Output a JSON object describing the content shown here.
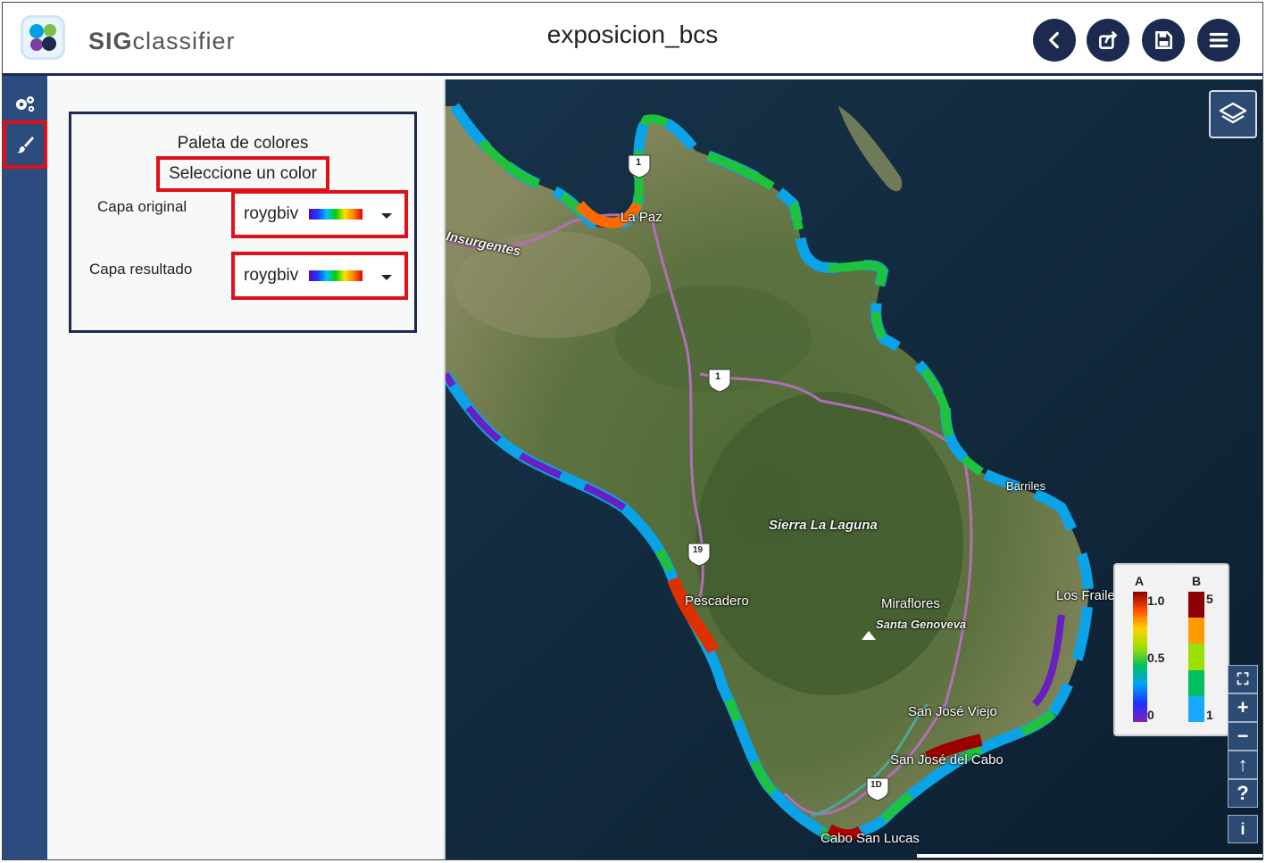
{
  "app": {
    "brand_bold": "SIG",
    "brand_rest": "classifier",
    "document_title": "exposicion_bcs"
  },
  "header_buttons": [
    {
      "name": "back-button",
      "icon": "chevron-left-icon"
    },
    {
      "name": "share-button",
      "icon": "share-icon"
    },
    {
      "name": "save-button",
      "icon": "save-icon"
    },
    {
      "name": "menu-button",
      "icon": "hamburger-icon"
    }
  ],
  "rail": [
    {
      "name": "settings",
      "icon": "gears-icon",
      "active": false
    },
    {
      "name": "palette",
      "icon": "paintbrush-icon",
      "active": true
    }
  ],
  "palette": {
    "title": "Paleta de colores",
    "select_message": "Seleccione un color",
    "original_label": "Capa original",
    "original_value": "roygbiv",
    "result_label": "Capa resultado",
    "result_value": "roygbiv"
  },
  "map": {
    "places": {
      "la_paz": "La Paz",
      "insurgentes": "Insurgentes",
      "sierra": "Sierra La Laguna",
      "pescadero": "Pescadero",
      "miraflores": "Miraflores",
      "santa_genoveva": "Santa Genoveva",
      "san_jose_viejo": "San José Viejo",
      "san_jose_cabo": "San José del Cabo",
      "cabo_san_lucas": "Cabo San Lucas",
      "los_frailes": "Los Frailes",
      "barriles": "Barriles"
    },
    "highway_shields": [
      "1",
      "1",
      "19",
      "1D"
    ]
  },
  "legend": {
    "a_label": "A",
    "a_max": "1.0",
    "a_mid": "0.5",
    "a_min": "0",
    "b_label": "B",
    "b_max": "5",
    "b_min": "1",
    "b_colors": [
      "#8b0000",
      "#ff9a00",
      "#9be000",
      "#00c060",
      "#19a8ff"
    ]
  },
  "map_controls": {
    "fullscreen": "⛶",
    "zoom_in": "+",
    "zoom_out": "−",
    "north": "↑",
    "help": "?",
    "info": "i"
  }
}
